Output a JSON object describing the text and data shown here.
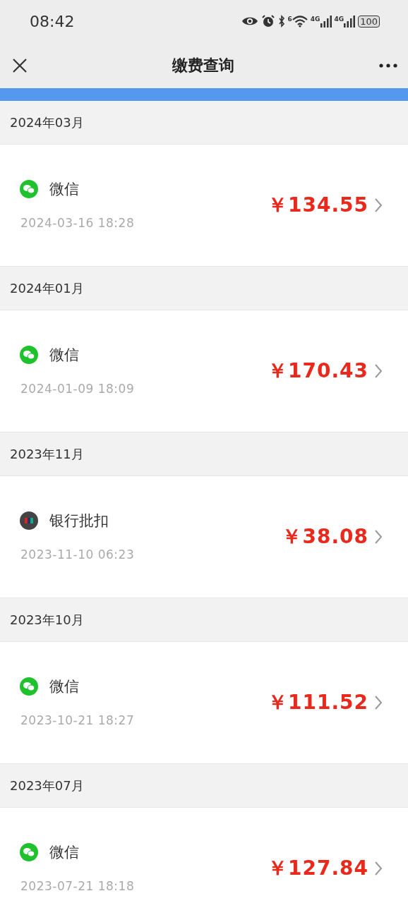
{
  "status_bar": {
    "time": "08:42",
    "wifi_label": "6",
    "signals": [
      "4G",
      "4G"
    ],
    "battery": "100"
  },
  "nav": {
    "title": "缴费查询"
  },
  "groups": [
    {
      "month": "2024年03月",
      "records": [
        {
          "kind": "wechat",
          "method": "微信",
          "datetime": "2024-03-16 18:28",
          "amount": "￥134.55"
        }
      ]
    },
    {
      "month": "2024年01月",
      "records": [
        {
          "kind": "wechat",
          "method": "微信",
          "datetime": "2024-01-09 18:09",
          "amount": "￥170.43"
        }
      ]
    },
    {
      "month": "2023年11月",
      "records": [
        {
          "kind": "bank",
          "method": "银行批扣",
          "datetime": "2023-11-10 06:23",
          "amount": "￥38.08"
        }
      ]
    },
    {
      "month": "2023年10月",
      "records": [
        {
          "kind": "wechat",
          "method": "微信",
          "datetime": "2023-10-21 18:27",
          "amount": "￥111.52"
        }
      ]
    },
    {
      "month": "2023年07月",
      "records": [
        {
          "kind": "wechat",
          "method": "微信",
          "datetime": "2023-07-21 18:18",
          "amount": "￥127.84"
        }
      ]
    }
  ]
}
